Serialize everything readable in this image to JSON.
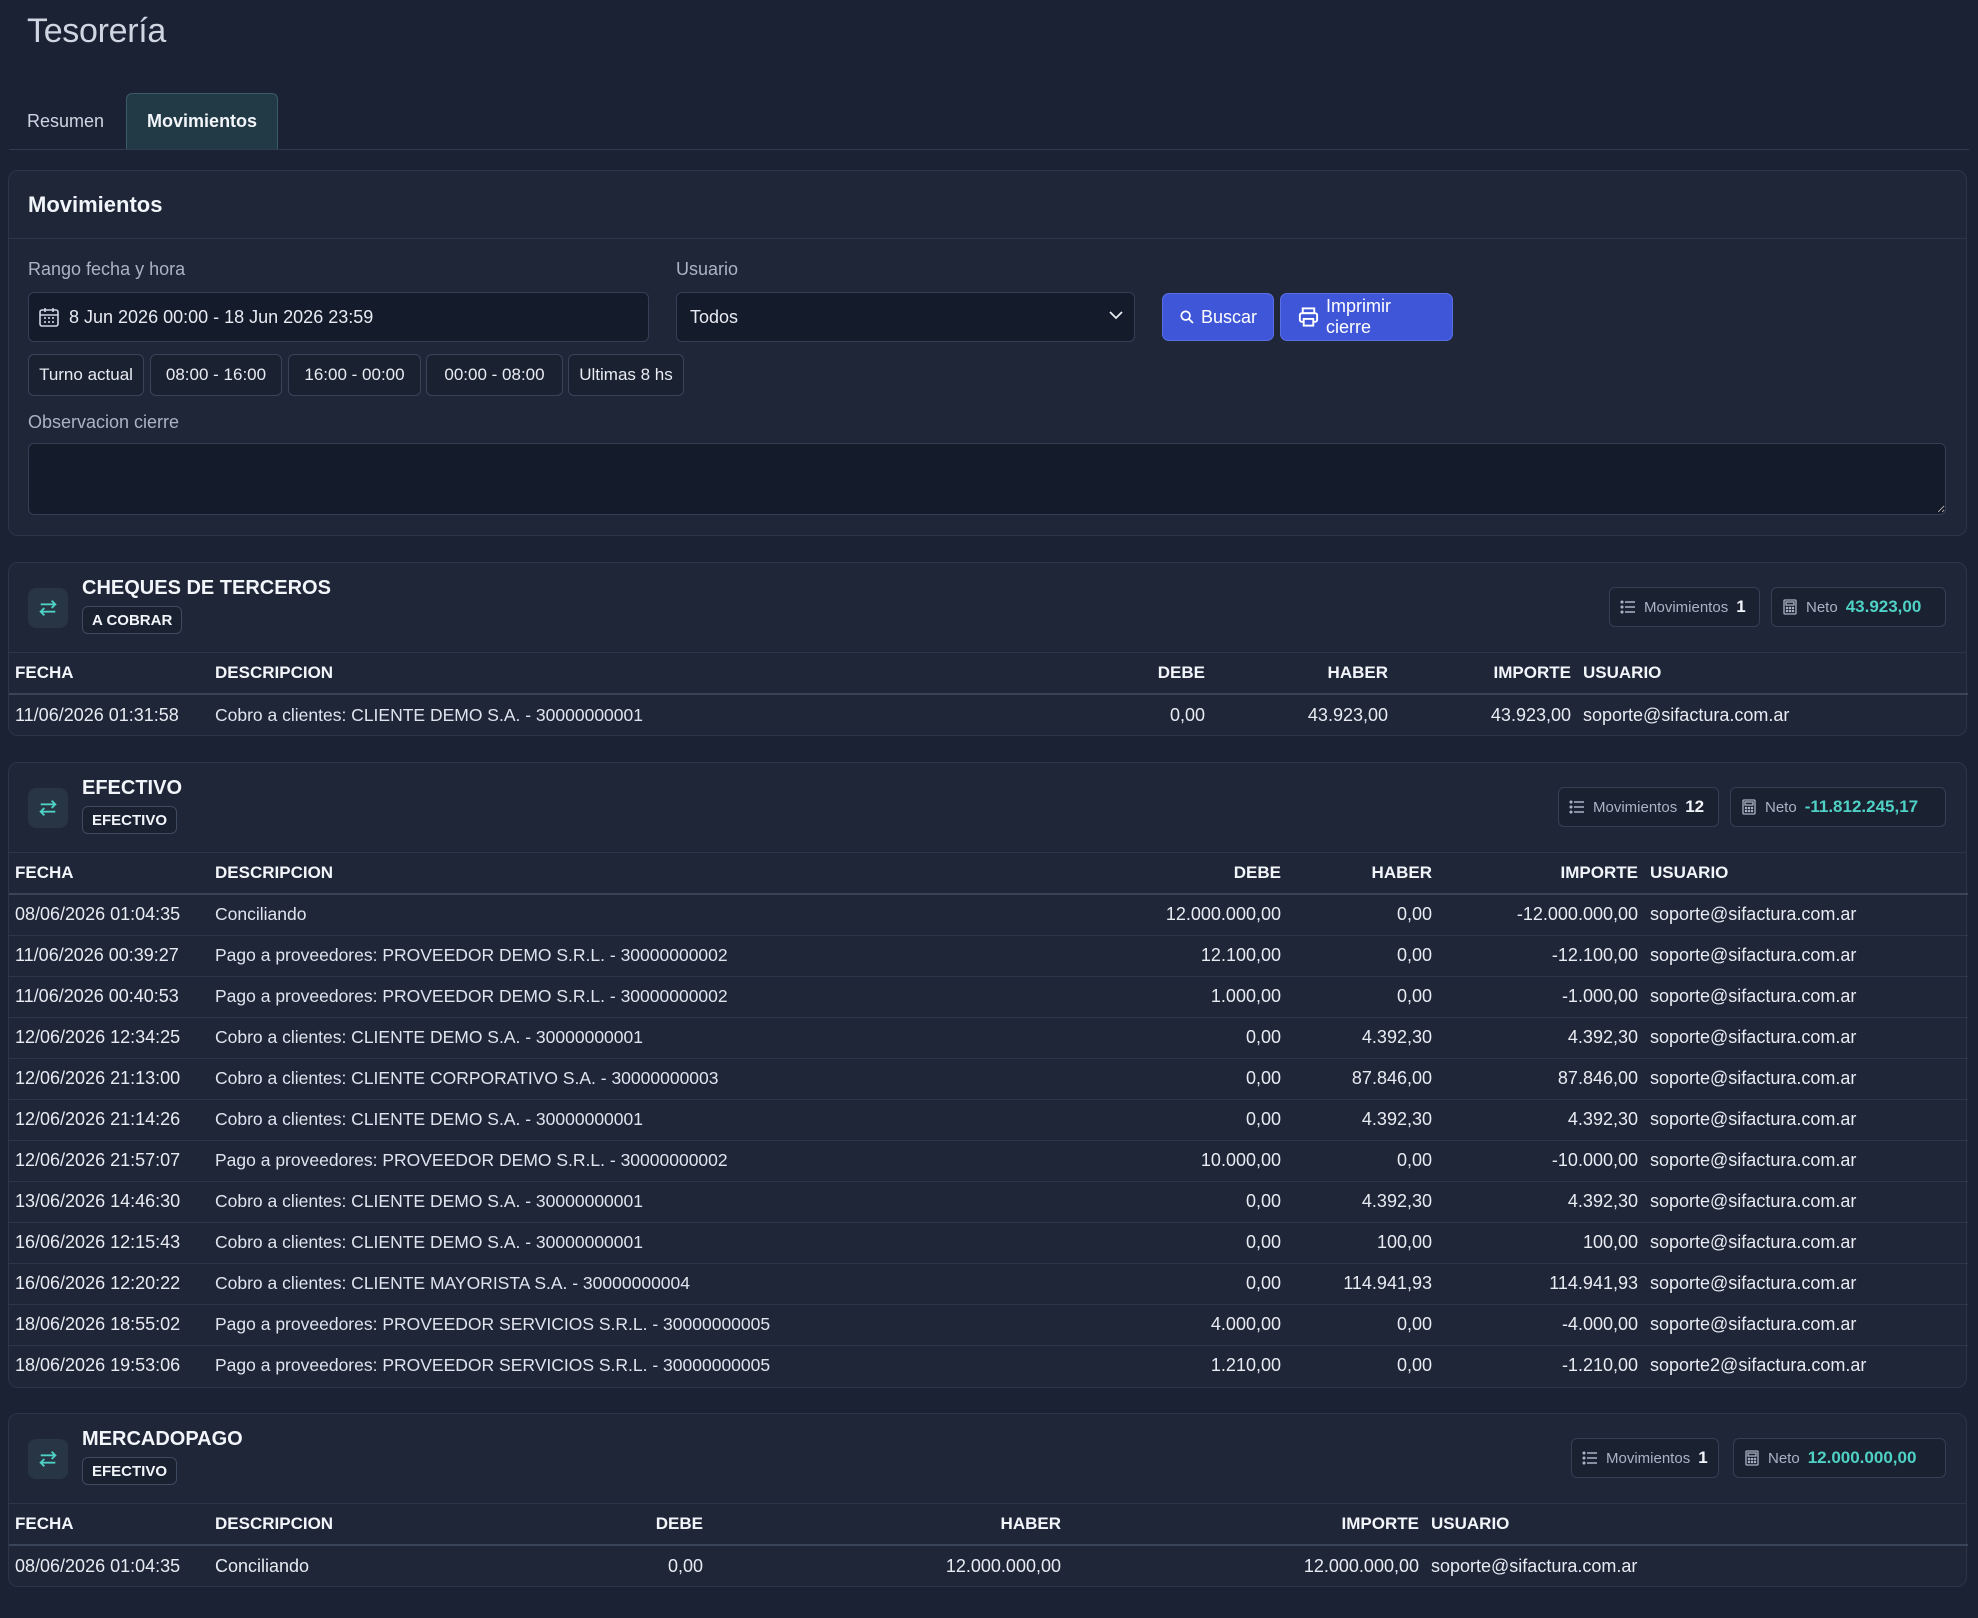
{
  "page": {
    "title": "Tesorería"
  },
  "tabs": [
    {
      "label": "Resumen",
      "active": false
    },
    {
      "label": "Movimientos",
      "active": true
    }
  ],
  "filters": {
    "card_title": "Movimientos",
    "date_range_label": "Rango fecha y hora",
    "date_range_value": "8 Jun 2026 00:00 - 18 Jun 2026 23:59",
    "user_label": "Usuario",
    "user_value": "Todos",
    "search_button": "Buscar",
    "print_button": "Imprimir cierre",
    "quick_ranges": [
      "Turno actual",
      "08:00 - 16:00",
      "16:00 - 00:00",
      "00:00 - 08:00",
      "Ultimas 8 hs"
    ],
    "observation_label": "Observacion cierre",
    "observation_value": ""
  },
  "columns": {
    "fecha": "FECHA",
    "descripcion": "DESCRIPCION",
    "debe": "DEBE",
    "haber": "HABER",
    "importe": "IMPORTE",
    "usuario": "USUARIO"
  },
  "sections": [
    {
      "title": "CHEQUES DE TERCEROS",
      "badge": "A COBRAR",
      "movimientos_label": "Movimientos",
      "movimientos_count": "1",
      "neto_label": "Neto",
      "neto_value": "43.923,00",
      "rows": [
        {
          "fecha": "11/06/2026 01:31:58",
          "descripcion": "Cobro a clientes: CLIENTE DEMO S.A. - 30000000001",
          "debe": "0,00",
          "haber": "43.923,00",
          "importe": "43.923,00",
          "usuario": "soporte@sifactura.com.ar"
        }
      ]
    },
    {
      "title": "EFECTIVO",
      "badge": "EFECTIVO",
      "movimientos_label": "Movimientos",
      "movimientos_count": "12",
      "neto_label": "Neto",
      "neto_value": "-11.812.245,17",
      "rows": [
        {
          "fecha": "08/06/2026 01:04:35",
          "descripcion": "Conciliando",
          "debe": "12.000.000,00",
          "haber": "0,00",
          "importe": "-12.000.000,00",
          "usuario": "soporte@sifactura.com.ar"
        },
        {
          "fecha": "11/06/2026 00:39:27",
          "descripcion": "Pago a proveedores: PROVEEDOR DEMO S.R.L. - 30000000002",
          "debe": "12.100,00",
          "haber": "0,00",
          "importe": "-12.100,00",
          "usuario": "soporte@sifactura.com.ar"
        },
        {
          "fecha": "11/06/2026 00:40:53",
          "descripcion": "Pago a proveedores: PROVEEDOR DEMO S.R.L. - 30000000002",
          "debe": "1.000,00",
          "haber": "0,00",
          "importe": "-1.000,00",
          "usuario": "soporte@sifactura.com.ar"
        },
        {
          "fecha": "12/06/2026 12:34:25",
          "descripcion": "Cobro a clientes: CLIENTE DEMO S.A. - 30000000001",
          "debe": "0,00",
          "haber": "4.392,30",
          "importe": "4.392,30",
          "usuario": "soporte@sifactura.com.ar"
        },
        {
          "fecha": "12/06/2026 21:13:00",
          "descripcion": "Cobro a clientes: CLIENTE CORPORATIVO S.A. - 30000000003",
          "debe": "0,00",
          "haber": "87.846,00",
          "importe": "87.846,00",
          "usuario": "soporte@sifactura.com.ar"
        },
        {
          "fecha": "12/06/2026 21:14:26",
          "descripcion": "Cobro a clientes: CLIENTE DEMO S.A. - 30000000001",
          "debe": "0,00",
          "haber": "4.392,30",
          "importe": "4.392,30",
          "usuario": "soporte@sifactura.com.ar"
        },
        {
          "fecha": "12/06/2026 21:57:07",
          "descripcion": "Pago a proveedores: PROVEEDOR DEMO S.R.L. - 30000000002",
          "debe": "10.000,00",
          "haber": "0,00",
          "importe": "-10.000,00",
          "usuario": "soporte@sifactura.com.ar"
        },
        {
          "fecha": "13/06/2026 14:46:30",
          "descripcion": "Cobro a clientes: CLIENTE DEMO S.A. - 30000000001",
          "debe": "0,00",
          "haber": "4.392,30",
          "importe": "4.392,30",
          "usuario": "soporte@sifactura.com.ar"
        },
        {
          "fecha": "16/06/2026 12:15:43",
          "descripcion": "Cobro a clientes: CLIENTE DEMO S.A. - 30000000001",
          "debe": "0,00",
          "haber": "100,00",
          "importe": "100,00",
          "usuario": "soporte@sifactura.com.ar"
        },
        {
          "fecha": "16/06/2026 12:20:22",
          "descripcion": "Cobro a clientes: CLIENTE MAYORISTA S.A. - 30000000004",
          "debe": "0,00",
          "haber": "114.941,93",
          "importe": "114.941,93",
          "usuario": "soporte@sifactura.com.ar"
        },
        {
          "fecha": "18/06/2026 18:55:02",
          "descripcion": "Pago a proveedores: PROVEEDOR SERVICIOS S.R.L. - 30000000005",
          "debe": "4.000,00",
          "haber": "0,00",
          "importe": "-4.000,00",
          "usuario": "soporte@sifactura.com.ar"
        },
        {
          "fecha": "18/06/2026 19:53:06",
          "descripcion": "Pago a proveedores: PROVEEDOR SERVICIOS S.R.L. - 30000000005",
          "debe": "1.210,00",
          "haber": "0,00",
          "importe": "-1.210,00",
          "usuario": "soporte2@sifactura.com.ar"
        }
      ]
    },
    {
      "title": "MERCADOPAGO",
      "badge": "EFECTIVO",
      "movimientos_label": "Movimientos",
      "movimientos_count": "1",
      "neto_label": "Neto",
      "neto_value": "12.000.000,00",
      "rows": [
        {
          "fecha": "08/06/2026 01:04:35",
          "descripcion": "Conciliando",
          "debe": "0,00",
          "haber": "12.000.000,00",
          "importe": "12.000.000,00",
          "usuario": "soporte@sifactura.com.ar"
        }
      ]
    }
  ],
  "colors": {
    "background": "#1b2234",
    "card": "#1f2638",
    "primary": "#3f56d8",
    "accent_teal": "#4fd1c5"
  },
  "icons": {
    "calendar": "calendar-icon",
    "chevron": "chevron-down-icon",
    "search": "search-icon",
    "printer": "printer-icon",
    "transfer": "transfer-arrows-icon",
    "list": "list-icon",
    "calculator": "calculator-icon"
  }
}
